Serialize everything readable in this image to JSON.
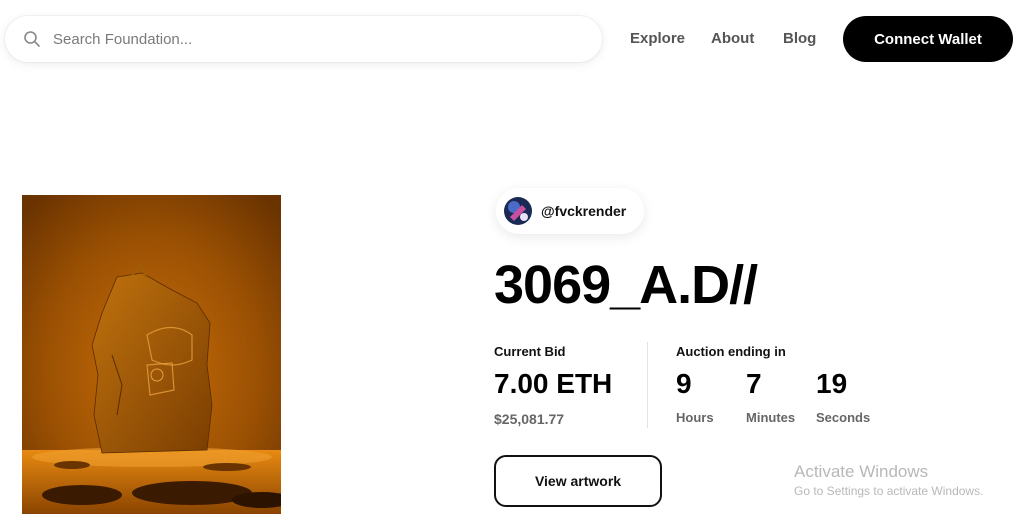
{
  "header": {
    "search": {
      "placeholder": "Search Foundation..."
    },
    "nav": [
      {
        "label": "Explore"
      },
      {
        "label": "About"
      },
      {
        "label": "Blog"
      }
    ],
    "connect_wallet_label": "Connect Wallet"
  },
  "creator": {
    "handle": "@fvckrender"
  },
  "artwork": {
    "title": "3069_A.D//"
  },
  "bid": {
    "label": "Current Bid",
    "amount": "7.00 ETH",
    "usd": "$25,081.77"
  },
  "auction": {
    "label": "Auction ending in",
    "hours": {
      "value": "9",
      "unit": "Hours"
    },
    "minutes": {
      "value": "7",
      "unit": "Minutes"
    },
    "seconds": {
      "value": "19",
      "unit": "Seconds"
    }
  },
  "view_artwork_label": "View artwork",
  "watermark": {
    "title": "Activate Windows",
    "subtitle": "Go to Settings to activate Windows."
  },
  "colors": {
    "accent": "#000000",
    "artwork_bg": "#a85a05",
    "artwork_glow": "#e07a0a"
  },
  "icons": {
    "search": "search-icon"
  }
}
